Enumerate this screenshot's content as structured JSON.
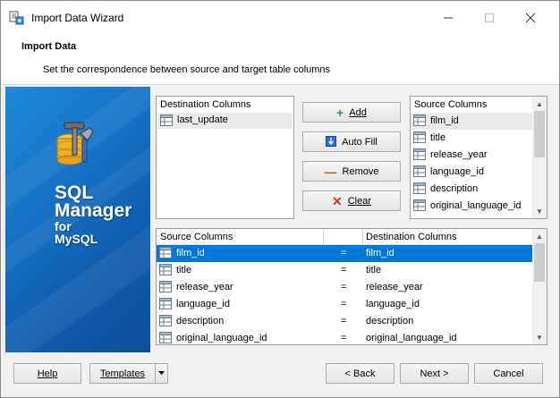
{
  "window": {
    "title": "Import Data Wizard"
  },
  "header": {
    "title": "Import Data",
    "subtitle": "Set the correspondence between source and target table columns"
  },
  "banner": {
    "line1": "SQL",
    "line2": "Manager",
    "line3": "for",
    "line4": "MySQL"
  },
  "destination": {
    "heading": "Destination Columns",
    "items": [
      "last_update"
    ]
  },
  "actions": {
    "add_label": "Add",
    "autofill_label": "Auto Fill",
    "remove_label": "Remove",
    "clear_label": "Clear"
  },
  "source": {
    "heading": "Source Columns",
    "items": [
      "film_id",
      "title",
      "release_year",
      "language_id",
      "description",
      "original_language_id"
    ]
  },
  "mapping": {
    "source_header": "Source Columns",
    "dest_header": "Destination Columns",
    "rows": [
      {
        "src": "film_id",
        "eq": "=",
        "dst": "film_id"
      },
      {
        "src": "title",
        "eq": "=",
        "dst": "title"
      },
      {
        "src": "release_year",
        "eq": "=",
        "dst": "release_year"
      },
      {
        "src": "language_id",
        "eq": "=",
        "dst": "language_id"
      },
      {
        "src": "description",
        "eq": "=",
        "dst": "description"
      },
      {
        "src": "original_language_id",
        "eq": "=",
        "dst": "original_language_id"
      }
    ]
  },
  "footer": {
    "help_label": "Help",
    "templates_label": "Templates",
    "back_label": "< Back",
    "next_label": "Next >",
    "cancel_label": "Cancel"
  },
  "colors": {
    "selection": "#0078d7",
    "banner": "#1673c6",
    "add": "#2e9e3a",
    "remove": "#d9531e",
    "clear": "#d9331e"
  }
}
